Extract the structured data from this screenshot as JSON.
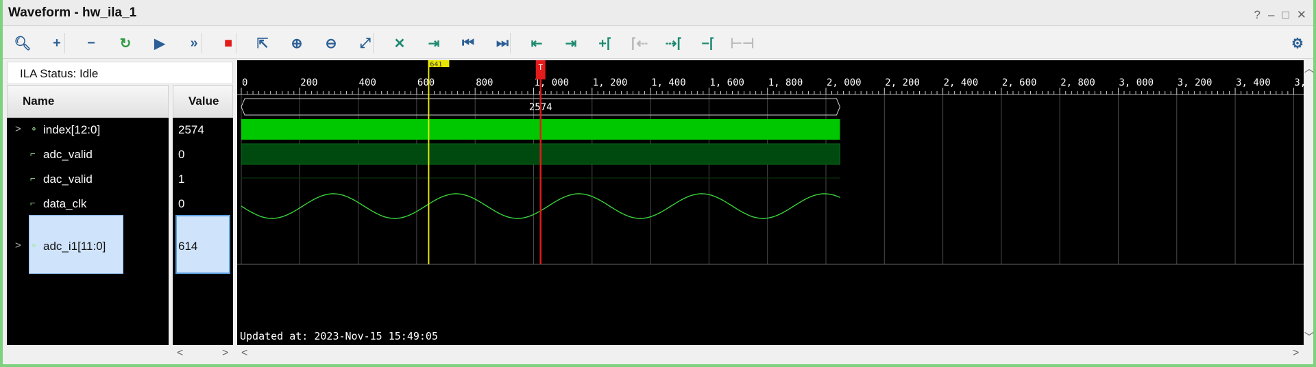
{
  "window": {
    "title": "Waveform - hw_ila_1",
    "controls": [
      "?",
      "–",
      "□",
      "✕"
    ]
  },
  "toolbar": {
    "buttons": [
      {
        "name": "search-icon",
        "glyph": "🔍︎"
      },
      {
        "name": "zoom-add-icon",
        "glyph": "+"
      },
      {
        "name": "remove-icon",
        "glyph": "−"
      },
      {
        "name": "run-trigger-immediate-icon",
        "glyph": "↻"
      },
      {
        "name": "run-trigger-icon",
        "glyph": "▶"
      },
      {
        "name": "run-continuous-icon",
        "glyph": "»"
      },
      {
        "name": "stop-icon",
        "glyph": "■"
      },
      {
        "name": "export-icon",
        "glyph": "⇱"
      },
      {
        "name": "zoom-in-icon",
        "glyph": "⊕"
      },
      {
        "name": "zoom-out-icon",
        "glyph": "⊖"
      },
      {
        "name": "zoom-fit-icon",
        "glyph": "⤢"
      },
      {
        "name": "cursor-toggle-icon",
        "glyph": "✕"
      },
      {
        "name": "go-to-cursor-icon",
        "glyph": "⇥"
      },
      {
        "name": "go-to-start-icon",
        "glyph": "⏮"
      },
      {
        "name": "go-to-end-icon",
        "glyph": "⏭"
      },
      {
        "name": "previous-transition-icon",
        "glyph": "⇤"
      },
      {
        "name": "next-transition-icon",
        "glyph": "⇥"
      },
      {
        "name": "add-marker-icon",
        "glyph": "+⌈"
      },
      {
        "name": "previous-marker-icon",
        "glyph": "⌈⇠"
      },
      {
        "name": "next-marker-icon",
        "glyph": "⇢⌈"
      },
      {
        "name": "delete-marker-icon",
        "glyph": "−⌈"
      },
      {
        "name": "swap-cursors-icon",
        "glyph": "⊢⊣"
      }
    ],
    "settings_glyph": "⚙"
  },
  "ila_status": "ILA Status:  Idle",
  "columns": {
    "name": "Name",
    "value": "Value"
  },
  "signals": [
    {
      "name": "index[12:0]",
      "value": "2574",
      "expandable": true,
      "type": "bus"
    },
    {
      "name": "adc_valid",
      "value": "0",
      "expandable": false,
      "type": "bit"
    },
    {
      "name": "dac_valid",
      "value": "1",
      "expandable": false,
      "type": "bit"
    },
    {
      "name": "data_clk",
      "value": "0",
      "expandable": false,
      "type": "bit"
    },
    {
      "name": "adc_i1[11:0]",
      "value": "614",
      "expandable": true,
      "type": "analog",
      "selected": true
    }
  ],
  "waveform": {
    "ruler_labels": [
      "0",
      "200",
      "400",
      "600",
      "800",
      "1, 000",
      "1, 200",
      "1, 400",
      "1, 600",
      "1, 800",
      "2, 000",
      "2, 200",
      "2, 400",
      "2, 600",
      "2, 800",
      "3, 000",
      "3, 200",
      "3, 400",
      "3,"
    ],
    "sample_count": 2048,
    "cursor": {
      "label": "641",
      "position": 641,
      "color": "#e6e600"
    },
    "trigger": {
      "label": "T",
      "position": 1024,
      "color": "#e31b1b"
    },
    "bus_value": "2574",
    "colors": {
      "adc_valid": "#00c800",
      "dac_valid": "#004a10",
      "analog": "#3bd43b",
      "grid": "#4a4a4a"
    },
    "updated_text": "Updated at: 2023-Nov-15 15:49:05"
  },
  "scroll": {
    "left": "<",
    "right": ">",
    "up": "︿",
    "down": "﹀"
  }
}
